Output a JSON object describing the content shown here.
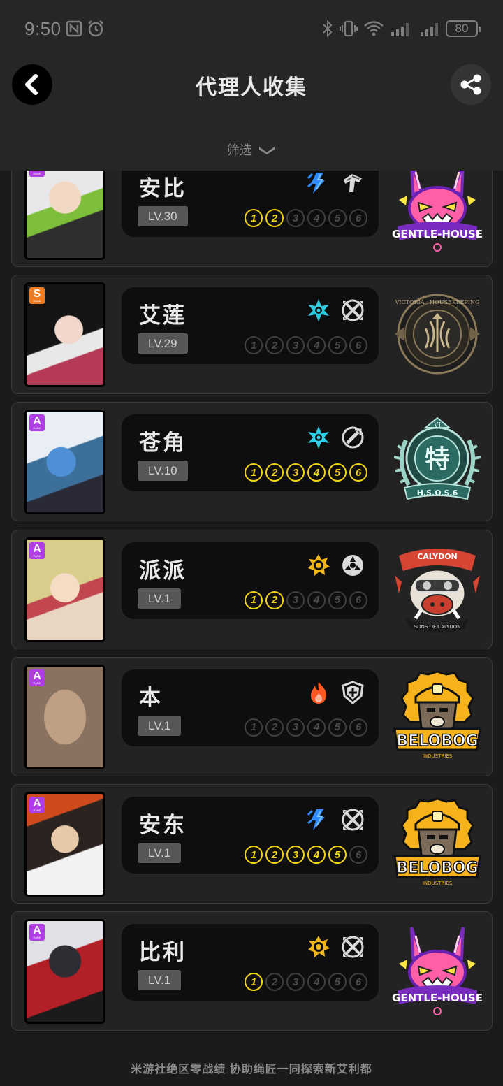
{
  "status_bar": {
    "time": "9:50",
    "battery": "80"
  },
  "header": {
    "title": "代理人收集",
    "filter_label": "筛选"
  },
  "agents": [
    {
      "name": "安比",
      "level": "LV.30",
      "rank": "A",
      "rank_sub": "RANK",
      "attribute": "electric",
      "specialty": "stun",
      "cinema_unlocked": 2,
      "faction": "Cunning Hares",
      "faction_text": "GENTLE-HOUSE"
    },
    {
      "name": "艾莲",
      "level": "LV.29",
      "rank": "S",
      "rank_sub": "RANK",
      "attribute": "ice",
      "specialty": "attack",
      "cinema_unlocked": 0,
      "faction": "Victoria Housekeeping",
      "faction_text": "VICTORIA · HOUSEKEEPING"
    },
    {
      "name": "苍角",
      "level": "LV.10",
      "rank": "A",
      "rank_sub": "RANK",
      "attribute": "ice",
      "specialty": "support",
      "cinema_unlocked": 6,
      "faction": "H.S.O.S.6",
      "faction_text": "特",
      "faction_roman": "VI",
      "faction_motto": "H.S.O.S.6"
    },
    {
      "name": "派派",
      "level": "LV.1",
      "rank": "A",
      "rank_sub": "RANK",
      "attribute": "physical",
      "specialty": "anomaly",
      "cinema_unlocked": 2,
      "faction": "Sons of Calydon",
      "faction_text": "CALYDON",
      "faction_motto": "SONS OF CALYDON"
    },
    {
      "name": "本",
      "level": "LV.1",
      "rank": "A",
      "rank_sub": "RANK",
      "attribute": "fire",
      "specialty": "defense",
      "cinema_unlocked": 0,
      "faction": "Belobog Industries",
      "faction_text": "BELOBOG",
      "faction_motto": "INDUSTRIES"
    },
    {
      "name": "安东",
      "level": "LV.1",
      "rank": "A",
      "rank_sub": "RANK",
      "attribute": "electric",
      "specialty": "attack",
      "cinema_unlocked": 5,
      "faction": "Belobog Industries",
      "faction_text": "BELOBOG",
      "faction_motto": "INDUSTRIES"
    },
    {
      "name": "比利",
      "level": "LV.1",
      "rank": "A",
      "rank_sub": "RANK",
      "attribute": "physical",
      "specialty": "attack",
      "cinema_unlocked": 1,
      "faction": "Cunning Hares",
      "faction_text": "GENTLE-HOUSE"
    }
  ],
  "footer": {
    "text": "米游社绝区零战绩 协助绳匠一同探索新艾利都"
  },
  "colors": {
    "background": "#1b1b1b",
    "header": "#262626",
    "card": "#232323",
    "info_panel": "#0e0e0e",
    "cinema_active": "#f2d312",
    "electric": "#2f8cff",
    "ice": "#2cd0e6",
    "physical": "#f3b617",
    "fire": "#ff5722",
    "rank_a": "#b03ce6",
    "rank_s": "#f07a1c"
  },
  "icons": {
    "back": "chevron-left-icon",
    "share": "share-icon",
    "filter": "chevron-down-icon"
  }
}
